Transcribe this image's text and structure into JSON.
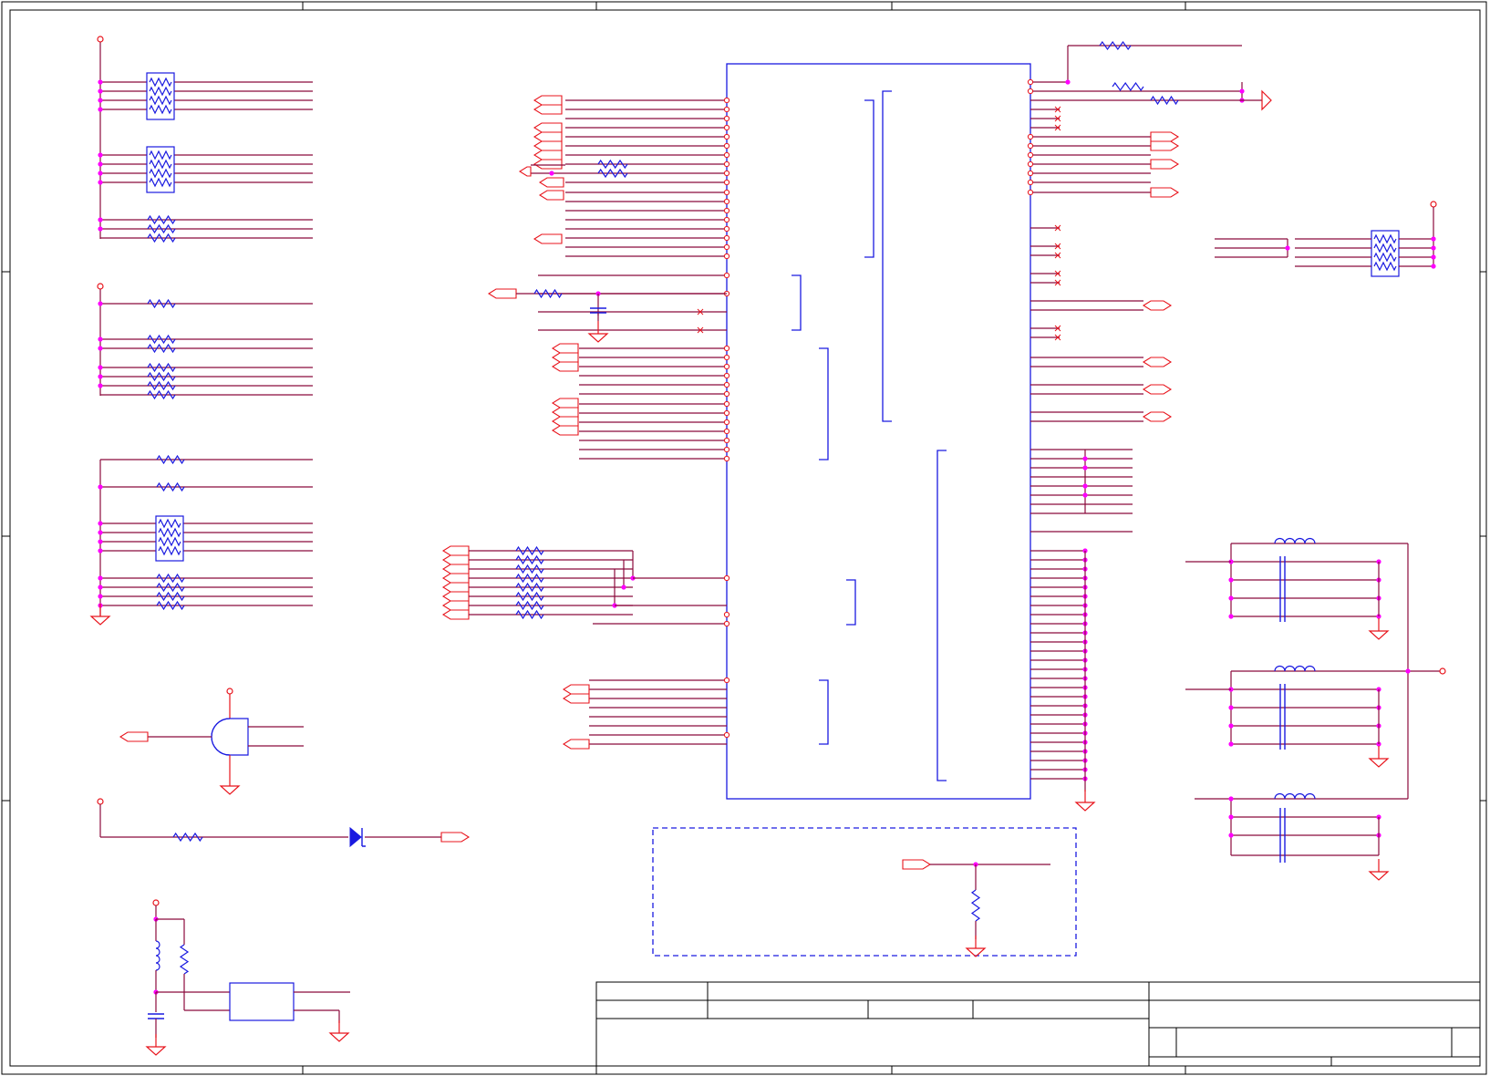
{
  "document": {
    "type": "schematic-sheet",
    "text": [],
    "title_block": {
      "title": "",
      "sheet": "",
      "revision": ""
    }
  },
  "colors": {
    "wire": "#8b0a3c",
    "pin_red": "#e8141c",
    "component_blue": "#1a1ae0",
    "junction": "#ff00ff",
    "frame": "#000000"
  },
  "icons": [
    "resistor-icon",
    "resistor-array-icon",
    "capacitor-icon",
    "inductor-icon",
    "ground-icon",
    "power-pin-icon",
    "port-flag-icon",
    "and-gate-icon",
    "diode-icon",
    "regulator-icon"
  ]
}
